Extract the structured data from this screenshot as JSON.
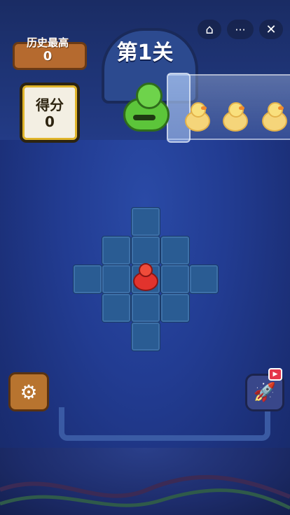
{
  "top_bar": {
    "home_icon": "home-icon",
    "more_icon": "more-dots-icon",
    "close_icon": "close-icon",
    "more_symbol": "···",
    "close_symbol": "✕",
    "home_symbol": "⌂"
  },
  "level": {
    "title": "第1关"
  },
  "best_score": {
    "label": "历史最高",
    "value": "0"
  },
  "score": {
    "label": "得分",
    "value": "0"
  },
  "controls": {
    "settings_icon": "gear-icon",
    "settings_symbol": "⚙",
    "rocket_icon": "rocket-icon",
    "rocket_symbol": "🚀",
    "video_badge_symbol": "▶"
  },
  "colors": {
    "background": "#223c92",
    "cell": "#2a5c93",
    "accent_gold": "#e0b52b",
    "wood": "#b8742f"
  }
}
